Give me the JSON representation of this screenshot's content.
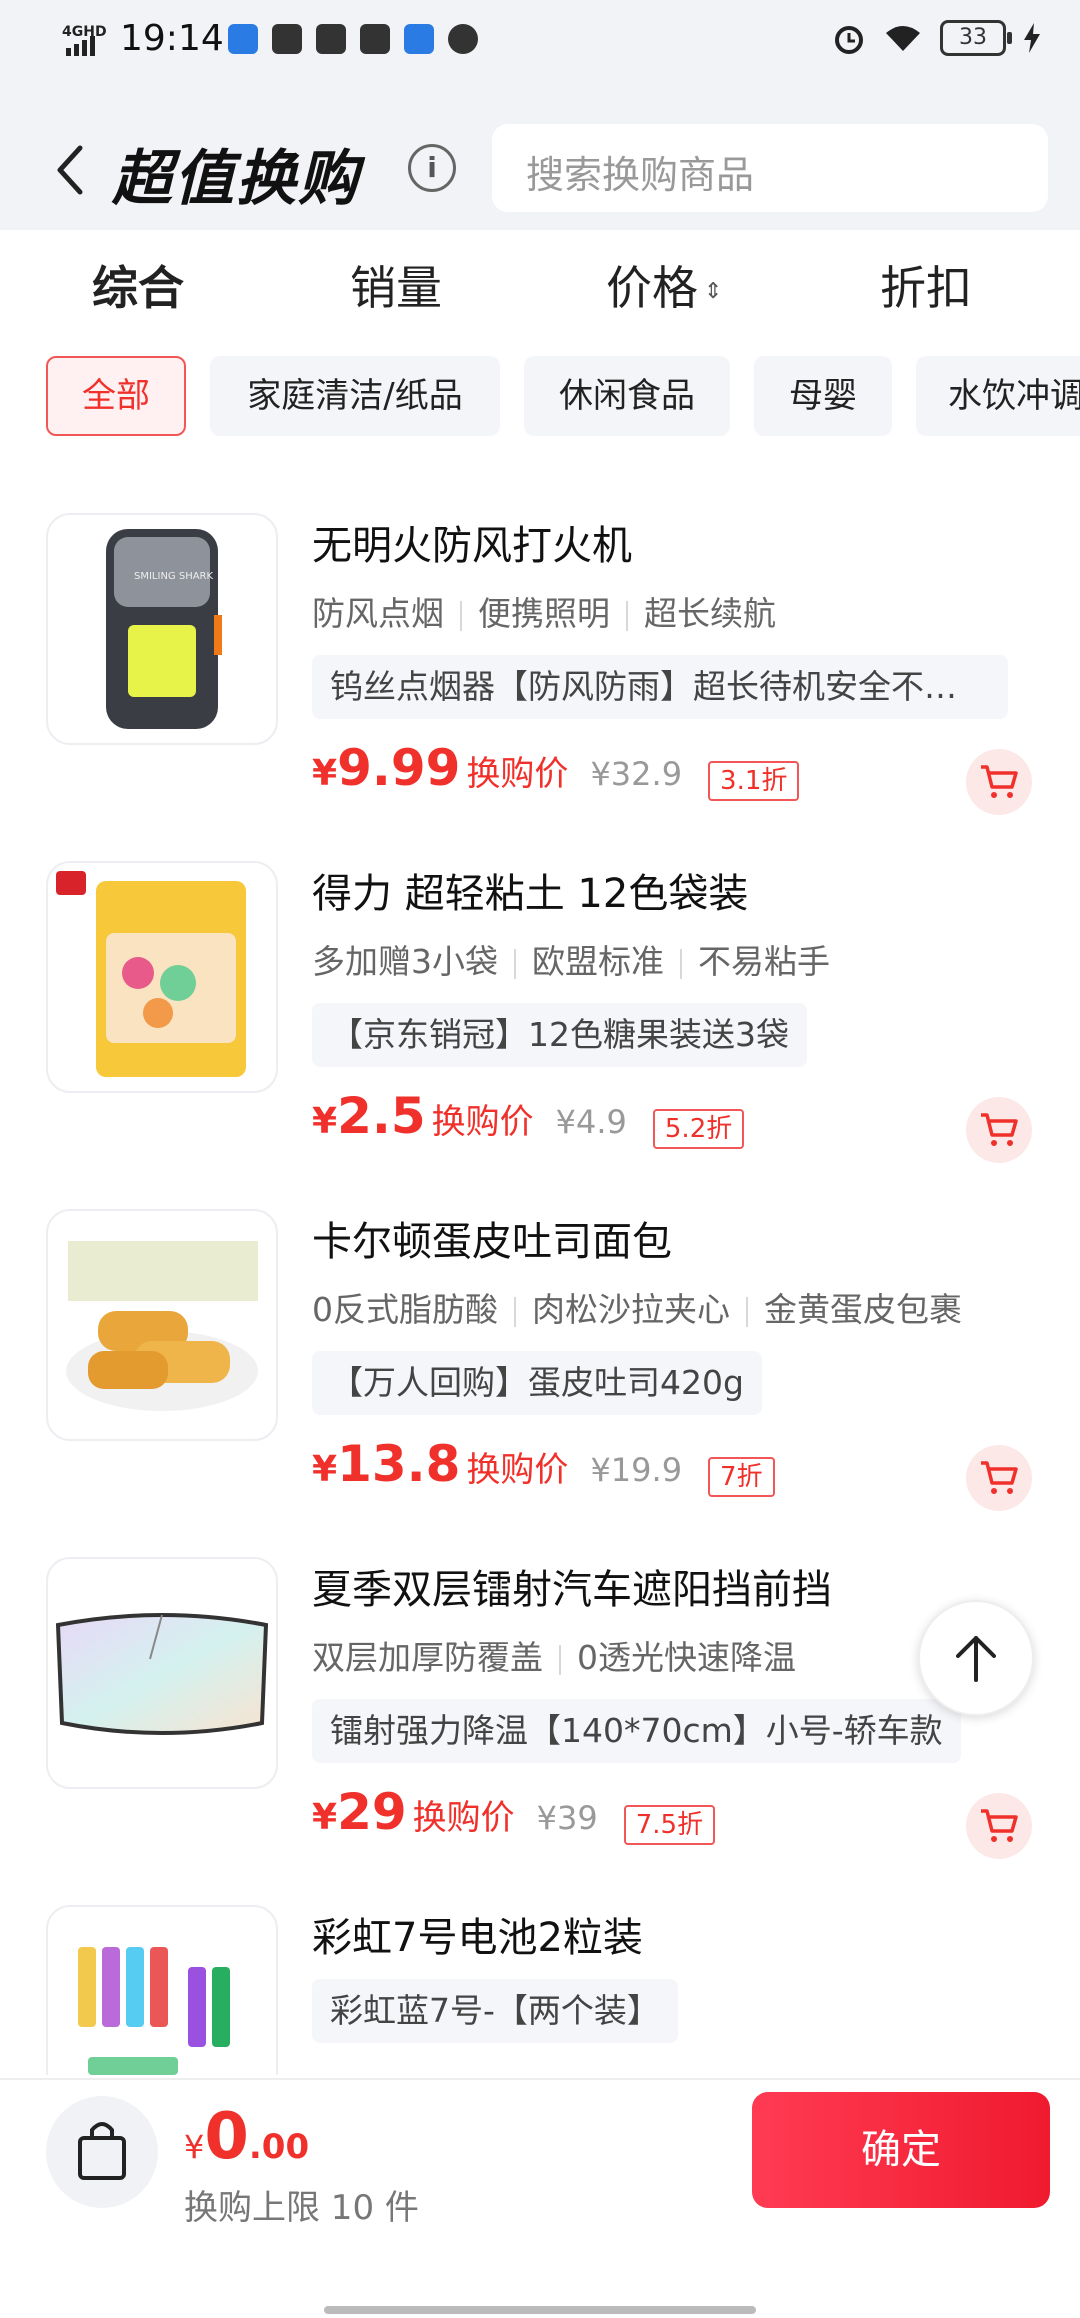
{
  "status_bar": {
    "time": "19:14",
    "signal": "4GHD",
    "battery": "33"
  },
  "header": {
    "title": "超值换购",
    "info_icon": "i",
    "search_placeholder": "搜索换购商品"
  },
  "sort_tabs": [
    {
      "label": "综合",
      "active": true
    },
    {
      "label": "销量",
      "active": false
    },
    {
      "label": "价格",
      "active": false
    },
    {
      "label": "折扣",
      "active": false
    }
  ],
  "categories": [
    {
      "label": "全部",
      "active": true
    },
    {
      "label": "家庭清洁/纸品",
      "active": false
    },
    {
      "label": "休闲食品",
      "active": false
    },
    {
      "label": "母婴",
      "active": false
    },
    {
      "label": "水饮冲调",
      "active": false
    }
  ],
  "products": [
    {
      "name": "无明火防风打火机",
      "tags": [
        "防风点烟",
        "便携照明",
        "超长续航"
      ],
      "desc": "钨丝点烟器【防风防雨】超长待机安全不…",
      "price_yen": "¥",
      "price": "9.99",
      "price_label": "换购价",
      "original": "¥32.9",
      "discount": "3.1折"
    },
    {
      "name": "得力 超轻粘土 12色袋装",
      "tags": [
        "多加赠3小袋",
        "欧盟标准",
        "不易粘手"
      ],
      "desc": "【京东销冠】12色糖果装送3袋",
      "price_yen": "¥",
      "price": "2.5",
      "price_label": "换购价",
      "original": "¥4.9",
      "discount": "5.2折"
    },
    {
      "name": "卡尔顿蛋皮吐司面包",
      "tags": [
        "0反式脂肪酸",
        "肉松沙拉夹心",
        "金黄蛋皮包裹"
      ],
      "desc": "【万人回购】蛋皮吐司420g",
      "price_yen": "¥",
      "price": "13.8",
      "price_label": "换购价",
      "original": "¥19.9",
      "discount": "7折"
    },
    {
      "name": "夏季双层镭射汽车遮阳挡前挡",
      "tags": [
        "双层加厚防覆盖",
        "0透光快速降温"
      ],
      "desc": "镭射强力降温【140*70cm】小号-轿车款",
      "price_yen": "¥",
      "price": "29",
      "price_label": "换购价",
      "original": "¥39",
      "discount": "7.5折"
    },
    {
      "name": "彩虹7号电池2粒装",
      "tags": [],
      "desc": "彩虹蓝7号-【两个装】"
    }
  ],
  "bottom_bar": {
    "total_yen": "¥",
    "total_int": "0",
    "total_dec": ".00",
    "limit_text": "换购上限 10 件",
    "confirm_label": "确定"
  }
}
